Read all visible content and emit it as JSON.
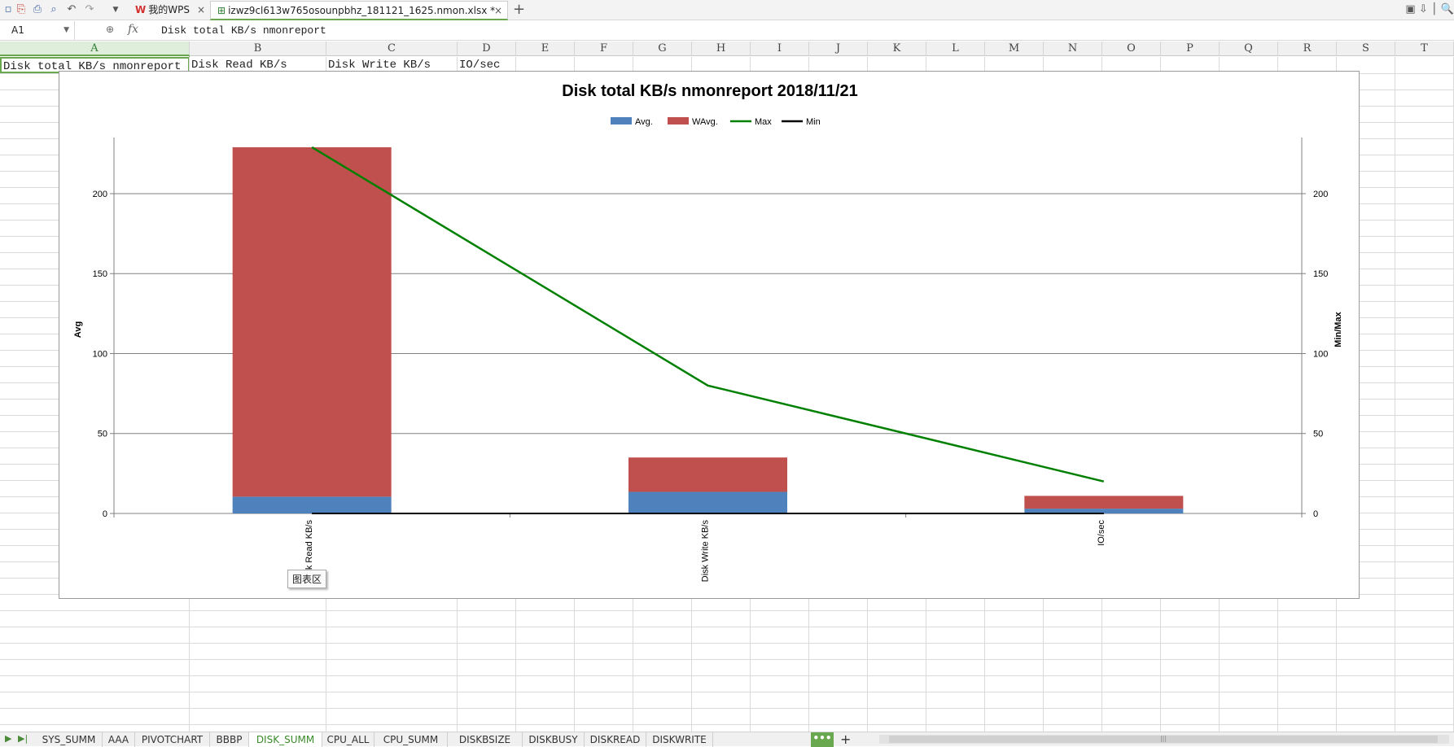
{
  "title_bar": {
    "tabs": [
      {
        "label": "我的WPS"
      },
      {
        "label": "izwz9cl613w765osounpbhz_181121_1625.nmon.xlsx *"
      }
    ]
  },
  "formula_bar": {
    "cell_ref": "A1",
    "fx_label": "fx",
    "content": "Disk total KB/s nmonreport"
  },
  "columns": [
    "A",
    "B",
    "C",
    "D",
    "E",
    "F",
    "G",
    "H",
    "I",
    "J",
    "K",
    "L",
    "M",
    "N",
    "O",
    "P",
    "Q",
    "R",
    "S",
    "T"
  ],
  "row1": {
    "A": "Disk total KB/s nmonreport",
    "B": "Disk Read KB/s",
    "C": "Disk Write KB/s",
    "D": "IO/sec"
  },
  "tooltip": "图表区",
  "sheets": [
    "SYS_SUMM",
    "AAA",
    "PIVOTCHART",
    "BBBP",
    "DISK_SUMM",
    "CPU_ALL",
    "CPU_SUMM",
    "DISKBSIZE",
    "DISKBUSY",
    "DISKREAD",
    "DISKWRITE"
  ],
  "active_sheet": "DISK_SUMM",
  "more_label": "•••",
  "colors": {
    "avg": "#4f81bd",
    "wavg": "#c0504d",
    "max": "#008000",
    "min": "#000000",
    "accent": "#6aa84f"
  },
  "chart_data": {
    "type": "bar",
    "title": "Disk total KB/s nmonreport  2018/11/21",
    "categories": [
      "Disk Read KB/s",
      "Disk Write KB/s",
      "IO/sec"
    ],
    "series": [
      {
        "name": "Avg.",
        "type": "stacked-bar",
        "values": [
          10.5,
          13.5,
          3.0
        ]
      },
      {
        "name": "WAvg.",
        "type": "stacked-bar",
        "values": [
          218.5,
          21.5,
          8.0
        ]
      },
      {
        "name": "Max",
        "type": "line",
        "values": [
          229,
          80,
          20
        ]
      },
      {
        "name": "Min",
        "type": "line",
        "values": [
          0,
          0,
          0
        ]
      }
    ],
    "ylabel": "Avg",
    "y2label": "Min/Max",
    "ylim": [
      0,
      230
    ],
    "yticks": [
      0,
      50,
      100,
      150,
      200
    ],
    "legend": "top",
    "grid": true
  }
}
